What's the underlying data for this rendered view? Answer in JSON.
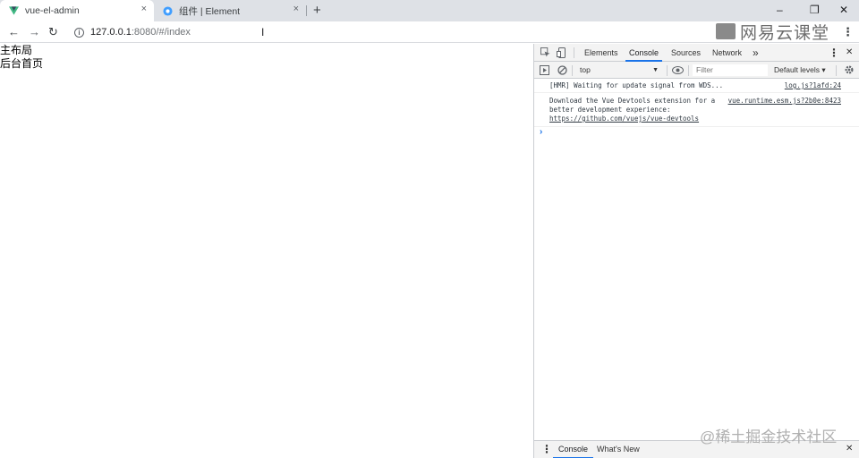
{
  "browser": {
    "tabs": [
      {
        "title": "vue-el-admin",
        "icon": "vue-icon",
        "active": true
      },
      {
        "title": "组件 | Element",
        "icon": "element-icon",
        "active": false
      }
    ],
    "new_tab_symbol": "+",
    "close_symbol": "×",
    "window_controls": {
      "minimize": "–",
      "restore": "❐",
      "close": "✕"
    },
    "nav": {
      "back": "←",
      "forward": "→",
      "reload": "↻"
    },
    "address": {
      "host": "127.0.0.1",
      "path": ":8080/#/index"
    },
    "menu_symbol": "⋮"
  },
  "page": {
    "lines": [
      "主布局",
      "后台首页"
    ]
  },
  "devtools": {
    "tabs": [
      "Elements",
      "Console",
      "Sources",
      "Network"
    ],
    "active_tab": "Console",
    "more_tabs_symbol": "»",
    "menu_symbol": "⋮",
    "close_symbol": "✕",
    "context": "top",
    "filter_placeholder": "Filter",
    "levels": "Default levels ▾",
    "messages": [
      {
        "text": "[HMR] Waiting for update signal from WDS...",
        "source": "log.js?1afd:24"
      },
      {
        "lines": [
          "Download the Vue Devtools extension for a",
          "better development experience:"
        ],
        "link": "https://github.com/vuejs/vue-devtools",
        "source": "vue.runtime.esm.js?2b0e:8423"
      }
    ],
    "prompt_symbol": "›",
    "drawer": {
      "tabs": [
        "Console",
        "What's New"
      ],
      "active_tab": "Console",
      "menu_symbol": "⋮",
      "close_symbol": "✕"
    }
  },
  "watermarks": {
    "top": "网易云课堂",
    "bottom": "@稀土掘金技术社区"
  }
}
